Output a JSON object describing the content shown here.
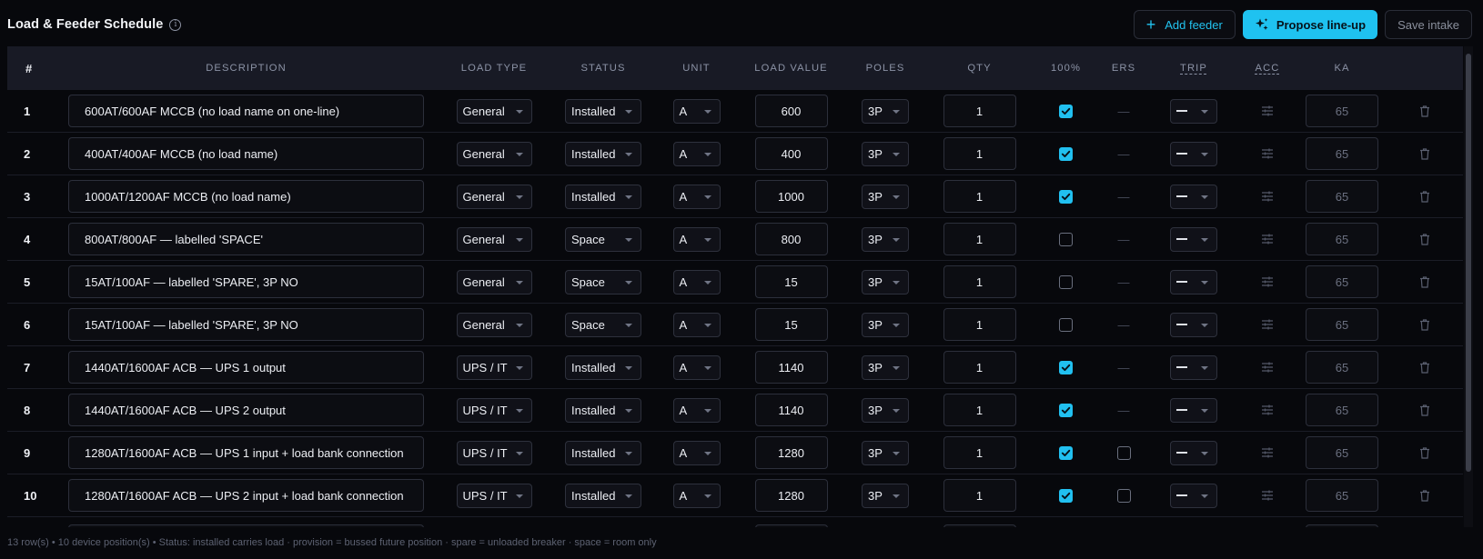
{
  "header": {
    "title": "Load & Feeder Schedule",
    "add_feeder_label": "Add feeder",
    "propose_label": "Propose line-up",
    "save_label": "Save intake"
  },
  "columns": {
    "num": "#",
    "description": "DESCRIPTION",
    "load_type": "LOAD TYPE",
    "status": "STATUS",
    "unit": "UNIT",
    "load_value": "LOAD VALUE",
    "poles": "POLES",
    "qty": "QTY",
    "pct100": "100%",
    "ers": "ERS",
    "trip": "TRIP",
    "acc": "ACC",
    "ka": "KA"
  },
  "rows": [
    {
      "num": "1",
      "description": "600AT/600AF MCCB (no load name on one-line)",
      "load_type": "General",
      "status": "Installed",
      "unit": "A",
      "load_value": "600",
      "poles": "3P",
      "qty": "1",
      "pct100": true,
      "ers": "—",
      "ka": "65"
    },
    {
      "num": "2",
      "description": "400AT/400AF MCCB (no load name)",
      "load_type": "General",
      "status": "Installed",
      "unit": "A",
      "load_value": "400",
      "poles": "3P",
      "qty": "1",
      "pct100": true,
      "ers": "—",
      "ka": "65"
    },
    {
      "num": "3",
      "description": "1000AT/1200AF MCCB (no load name)",
      "load_type": "General",
      "status": "Installed",
      "unit": "A",
      "load_value": "1000",
      "poles": "3P",
      "qty": "1",
      "pct100": true,
      "ers": "—",
      "ka": "65"
    },
    {
      "num": "4",
      "description": "800AT/800AF — labelled 'SPACE'",
      "load_type": "General",
      "status": "Space",
      "unit": "A",
      "load_value": "800",
      "poles": "3P",
      "qty": "1",
      "pct100": false,
      "ers": "—",
      "ka": "65"
    },
    {
      "num": "5",
      "description": "15AT/100AF — labelled 'SPARE', 3P NO",
      "load_type": "General",
      "status": "Space",
      "unit": "A",
      "load_value": "15",
      "poles": "3P",
      "qty": "1",
      "pct100": false,
      "ers": "—",
      "ka": "65"
    },
    {
      "num": "6",
      "description": "15AT/100AF — labelled 'SPARE', 3P NO",
      "load_type": "General",
      "status": "Space",
      "unit": "A",
      "load_value": "15",
      "poles": "3P",
      "qty": "1",
      "pct100": false,
      "ers": "—",
      "ka": "65"
    },
    {
      "num": "7",
      "description": "1440AT/1600AF ACB — UPS 1 output",
      "load_type": "UPS / IT",
      "status": "Installed",
      "unit": "A",
      "load_value": "1140",
      "poles": "3P",
      "qty": "1",
      "pct100": true,
      "ers": "—",
      "ka": "65"
    },
    {
      "num": "8",
      "description": "1440AT/1600AF ACB — UPS 2 output",
      "load_type": "UPS / IT",
      "status": "Installed",
      "unit": "A",
      "load_value": "1140",
      "poles": "3P",
      "qty": "1",
      "pct100": true,
      "ers": "—",
      "ka": "65"
    },
    {
      "num": "9",
      "description": "1280AT/1600AF ACB — UPS 1 input + load bank connection",
      "load_type": "UPS / IT",
      "status": "Installed",
      "unit": "A",
      "load_value": "1280",
      "poles": "3P",
      "qty": "1",
      "pct100": true,
      "ers": false,
      "ka": "65"
    },
    {
      "num": "10",
      "description": "1280AT/1600AF ACB — UPS 2 input + load bank connection",
      "load_type": "UPS / IT",
      "status": "Installed",
      "unit": "A",
      "load_value": "1280",
      "poles": "3P",
      "qty": "1",
      "pct100": true,
      "ers": false,
      "ka": "65"
    }
  ],
  "footer_text": "13 row(s) • 10 device position(s) • Status: installed carries load · provision = bussed future position · spare = unloaded breaker · space = room only",
  "colors": {
    "accent": "#1fc2f0",
    "background": "#07080c",
    "header_row": "#181a25"
  }
}
